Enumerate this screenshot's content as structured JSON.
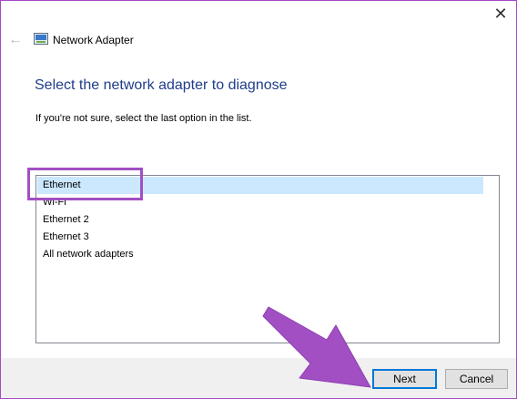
{
  "window": {
    "title": "Network Adapter",
    "close_glyph": "✕",
    "back_glyph": "←",
    "title_icon": "network-adapter-icon"
  },
  "main": {
    "heading": "Select the network adapter to diagnose",
    "hint": "If you're not sure, select the last option in the list."
  },
  "adapters": {
    "items": [
      {
        "label": "Ethernet",
        "selected": true
      },
      {
        "label": "Wi-Fi",
        "selected": false
      },
      {
        "label": "Ethernet 2",
        "selected": false
      },
      {
        "label": "Ethernet 3",
        "selected": false
      },
      {
        "label": "All network adapters",
        "selected": false
      }
    ]
  },
  "footer": {
    "next_label": "Next",
    "cancel_label": "Cancel"
  },
  "colors": {
    "heading": "#1f3d8a",
    "selection": "#cce8ff",
    "annotation": "#a24fc4",
    "default_button_border": "#0078d7"
  }
}
